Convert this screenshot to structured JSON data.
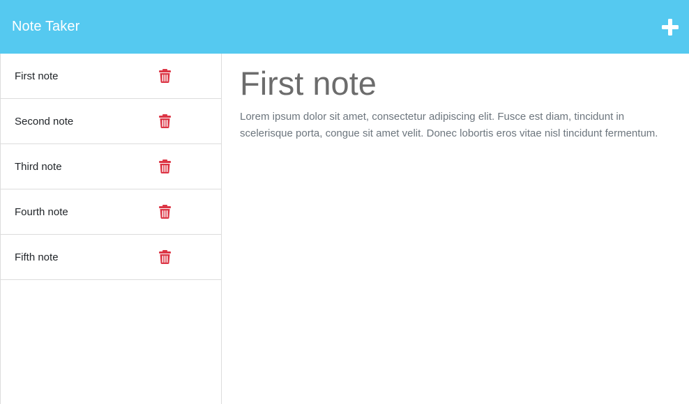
{
  "navbar": {
    "title": "Note Taker",
    "new_note_icon": "plus-icon",
    "icon_color": "#ffffff",
    "background": "#55c9f0"
  },
  "sidebar": {
    "notes": [
      {
        "title": "First note"
      },
      {
        "title": "Second note"
      },
      {
        "title": "Third note"
      },
      {
        "title": "Fourth note"
      },
      {
        "title": "Fifth note"
      }
    ],
    "delete_icon": "trash-icon",
    "delete_color": "#dc3545"
  },
  "main": {
    "note_title": "First note",
    "note_text": "Lorem ipsum dolor sit amet, consectetur adipiscing elit. Fusce est diam, tincidunt in scelerisque porta, congue sit amet velit. Donec lobortis eros vitae nisl tincidunt fermentum."
  }
}
